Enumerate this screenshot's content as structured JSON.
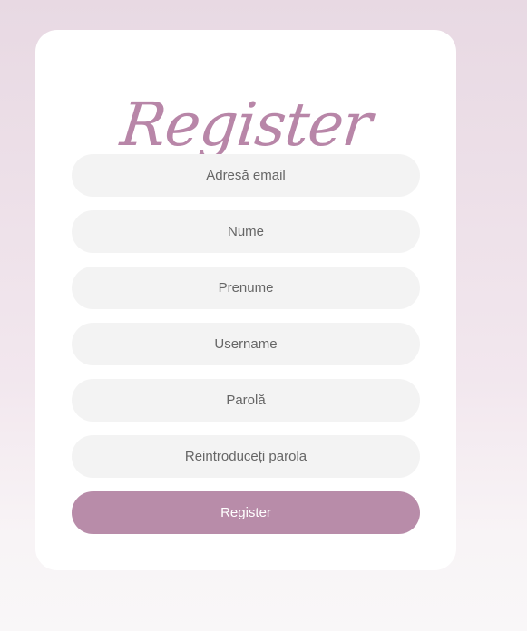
{
  "form": {
    "title": "Register",
    "fields": [
      {
        "placeholder": "Adresă email",
        "value": ""
      },
      {
        "placeholder": "Nume",
        "value": ""
      },
      {
        "placeholder": "Prenume",
        "value": ""
      },
      {
        "placeholder": "Username",
        "value": ""
      },
      {
        "placeholder": "Parolă",
        "value": ""
      },
      {
        "placeholder": "Reintroduceți parola",
        "value": ""
      }
    ],
    "submit_label": "Register"
  },
  "colors": {
    "accent": "#b88ca9",
    "title": "#b886a8",
    "field_background": "#f3f3f3",
    "card_background": "#ffffff"
  }
}
